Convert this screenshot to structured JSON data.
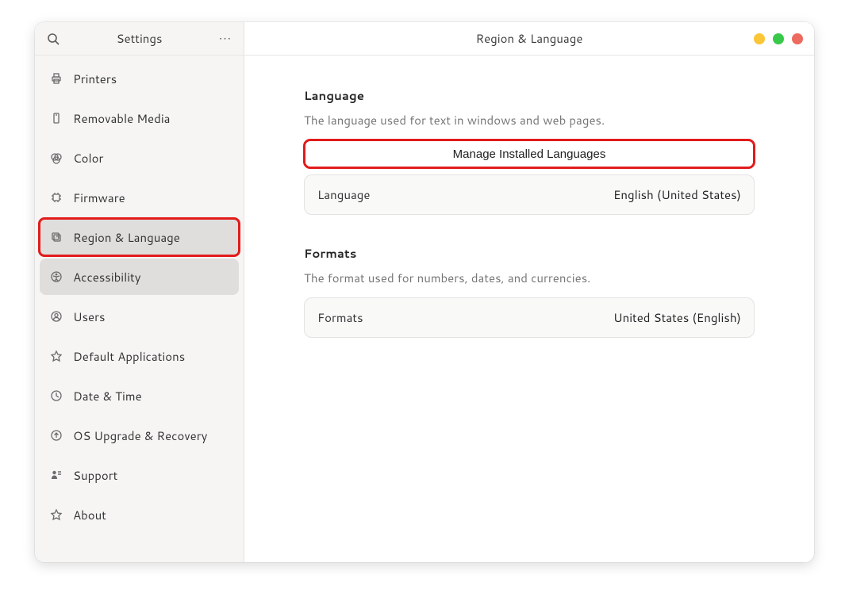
{
  "sidebar": {
    "title": "Settings",
    "items": [
      {
        "label": "Printers",
        "icon": "printer-icon"
      },
      {
        "label": "Removable Media",
        "icon": "media-icon"
      },
      {
        "label": "Color",
        "icon": "color-icon"
      },
      {
        "label": "Firmware",
        "icon": "chip-icon"
      },
      {
        "label": "Region & Language",
        "icon": "language-icon"
      },
      {
        "label": "Accessibility",
        "icon": "accessibility-icon"
      },
      {
        "label": "Users",
        "icon": "user-icon"
      },
      {
        "label": "Default Applications",
        "icon": "star-icon"
      },
      {
        "label": "Date & Time",
        "icon": "clock-icon"
      },
      {
        "label": "OS Upgrade & Recovery",
        "icon": "upgrade-icon"
      },
      {
        "label": "Support",
        "icon": "support-icon"
      },
      {
        "label": "About",
        "icon": "about-icon"
      }
    ]
  },
  "main": {
    "title": "Region & Language",
    "language": {
      "heading": "Language",
      "description": "The language used for text in windows and web pages.",
      "manage_button": "Manage Installed Languages",
      "row_label": "Language",
      "row_value": "English (United States)"
    },
    "formats": {
      "heading": "Formats",
      "description": "The format used for numbers, dates, and currencies.",
      "row_label": "Formats",
      "row_value": "United States (English)"
    }
  }
}
